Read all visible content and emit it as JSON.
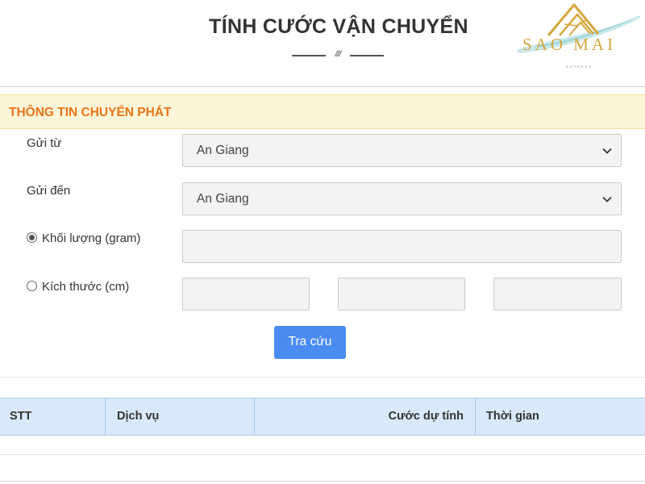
{
  "header": {
    "title": "TÍNH CƯỚC VẬN CHUYỂN",
    "logo_name": "SAO MAI",
    "logo_subtitle": "EXPRESS"
  },
  "section": {
    "title": "THÔNG TIN CHUYỂN PHÁT"
  },
  "form": {
    "from_label": "Gửi từ",
    "from_value": "An Giang",
    "to_label": "Gửi đến",
    "to_value": "An Giang",
    "weight_label": "Khối lượng (gram)",
    "weight_value": "",
    "weight_selected": true,
    "size_label": "Kích thước (cm)",
    "size_selected": false,
    "size_length": "",
    "size_width": "",
    "size_height": "",
    "submit_label": "Tra cứu"
  },
  "table": {
    "columns": [
      "STT",
      "Dịch vụ",
      "Cước dự tính",
      "Thời gian"
    ],
    "rows": []
  },
  "colors": {
    "accent_orange": "#e8751a",
    "button_blue": "#4a8bf2",
    "table_header": "#d9e9fb",
    "section_bar": "#fdf5d8",
    "logo_gold": "#d6a63b",
    "logo_teal": "#7fc6cf"
  },
  "icons": {
    "logo": "saomai-mountain-logo-icon",
    "select_caret": "chevron-down-icon"
  }
}
